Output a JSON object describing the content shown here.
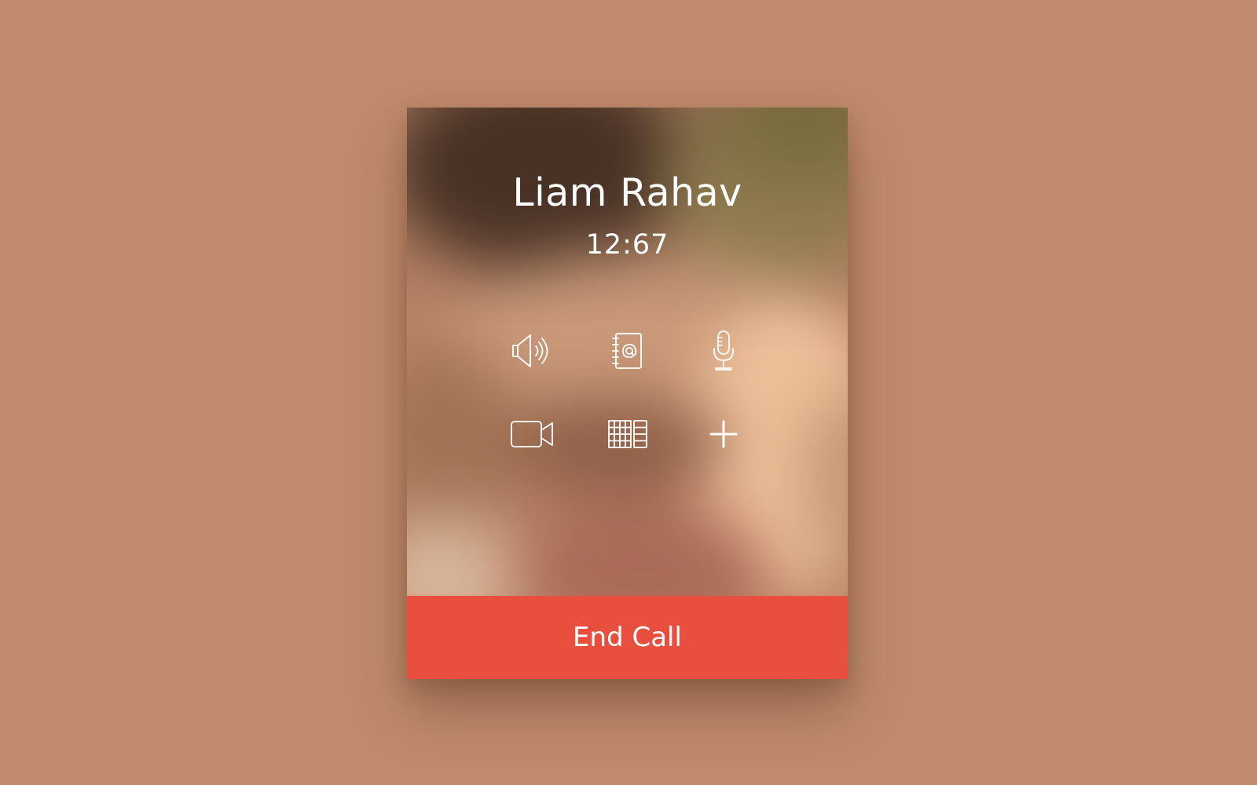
{
  "call": {
    "caller_name": "Liam Rahav",
    "duration": "12:67",
    "end_call_label": "End Call"
  },
  "controls": [
    {
      "name": "speaker",
      "icon": "speaker-icon"
    },
    {
      "name": "contacts",
      "icon": "address-book-icon"
    },
    {
      "name": "mute",
      "icon": "microphone-icon"
    },
    {
      "name": "video",
      "icon": "video-camera-icon"
    },
    {
      "name": "keypad",
      "icon": "keypad-icon"
    },
    {
      "name": "add-call",
      "icon": "plus-icon"
    }
  ],
  "colors": {
    "background": "#bf8b6c",
    "end_call": "#e84f3e",
    "icon": "#ffffff"
  }
}
